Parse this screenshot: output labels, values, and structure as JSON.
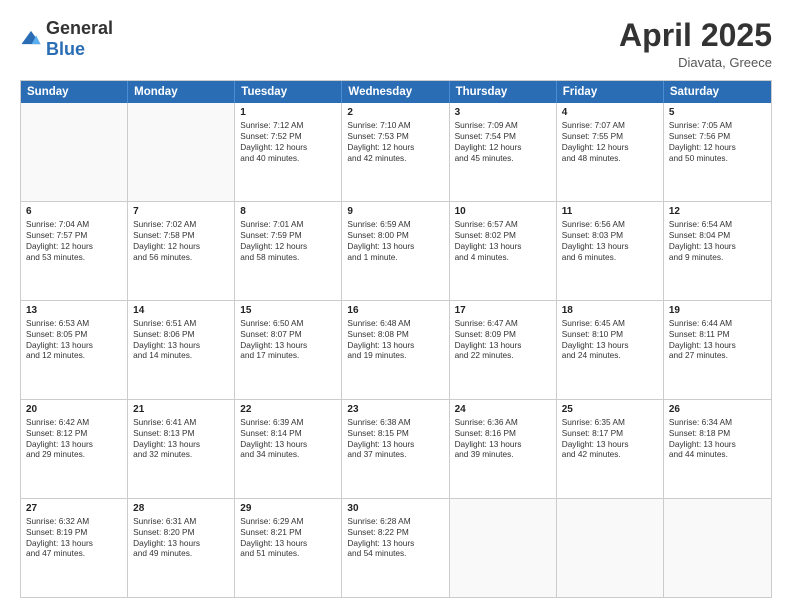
{
  "logo": {
    "general": "General",
    "blue": "Blue"
  },
  "title": "April 2025",
  "location": "Diavata, Greece",
  "days_of_week": [
    "Sunday",
    "Monday",
    "Tuesday",
    "Wednesday",
    "Thursday",
    "Friday",
    "Saturday"
  ],
  "rows": [
    [
      {
        "day": "",
        "lines": []
      },
      {
        "day": "",
        "lines": []
      },
      {
        "day": "1",
        "lines": [
          "Sunrise: 7:12 AM",
          "Sunset: 7:52 PM",
          "Daylight: 12 hours",
          "and 40 minutes."
        ]
      },
      {
        "day": "2",
        "lines": [
          "Sunrise: 7:10 AM",
          "Sunset: 7:53 PM",
          "Daylight: 12 hours",
          "and 42 minutes."
        ]
      },
      {
        "day": "3",
        "lines": [
          "Sunrise: 7:09 AM",
          "Sunset: 7:54 PM",
          "Daylight: 12 hours",
          "and 45 minutes."
        ]
      },
      {
        "day": "4",
        "lines": [
          "Sunrise: 7:07 AM",
          "Sunset: 7:55 PM",
          "Daylight: 12 hours",
          "and 48 minutes."
        ]
      },
      {
        "day": "5",
        "lines": [
          "Sunrise: 7:05 AM",
          "Sunset: 7:56 PM",
          "Daylight: 12 hours",
          "and 50 minutes."
        ]
      }
    ],
    [
      {
        "day": "6",
        "lines": [
          "Sunrise: 7:04 AM",
          "Sunset: 7:57 PM",
          "Daylight: 12 hours",
          "and 53 minutes."
        ]
      },
      {
        "day": "7",
        "lines": [
          "Sunrise: 7:02 AM",
          "Sunset: 7:58 PM",
          "Daylight: 12 hours",
          "and 56 minutes."
        ]
      },
      {
        "day": "8",
        "lines": [
          "Sunrise: 7:01 AM",
          "Sunset: 7:59 PM",
          "Daylight: 12 hours",
          "and 58 minutes."
        ]
      },
      {
        "day": "9",
        "lines": [
          "Sunrise: 6:59 AM",
          "Sunset: 8:00 PM",
          "Daylight: 13 hours",
          "and 1 minute."
        ]
      },
      {
        "day": "10",
        "lines": [
          "Sunrise: 6:57 AM",
          "Sunset: 8:02 PM",
          "Daylight: 13 hours",
          "and 4 minutes."
        ]
      },
      {
        "day": "11",
        "lines": [
          "Sunrise: 6:56 AM",
          "Sunset: 8:03 PM",
          "Daylight: 13 hours",
          "and 6 minutes."
        ]
      },
      {
        "day": "12",
        "lines": [
          "Sunrise: 6:54 AM",
          "Sunset: 8:04 PM",
          "Daylight: 13 hours",
          "and 9 minutes."
        ]
      }
    ],
    [
      {
        "day": "13",
        "lines": [
          "Sunrise: 6:53 AM",
          "Sunset: 8:05 PM",
          "Daylight: 13 hours",
          "and 12 minutes."
        ]
      },
      {
        "day": "14",
        "lines": [
          "Sunrise: 6:51 AM",
          "Sunset: 8:06 PM",
          "Daylight: 13 hours",
          "and 14 minutes."
        ]
      },
      {
        "day": "15",
        "lines": [
          "Sunrise: 6:50 AM",
          "Sunset: 8:07 PM",
          "Daylight: 13 hours",
          "and 17 minutes."
        ]
      },
      {
        "day": "16",
        "lines": [
          "Sunrise: 6:48 AM",
          "Sunset: 8:08 PM",
          "Daylight: 13 hours",
          "and 19 minutes."
        ]
      },
      {
        "day": "17",
        "lines": [
          "Sunrise: 6:47 AM",
          "Sunset: 8:09 PM",
          "Daylight: 13 hours",
          "and 22 minutes."
        ]
      },
      {
        "day": "18",
        "lines": [
          "Sunrise: 6:45 AM",
          "Sunset: 8:10 PM",
          "Daylight: 13 hours",
          "and 24 minutes."
        ]
      },
      {
        "day": "19",
        "lines": [
          "Sunrise: 6:44 AM",
          "Sunset: 8:11 PM",
          "Daylight: 13 hours",
          "and 27 minutes."
        ]
      }
    ],
    [
      {
        "day": "20",
        "lines": [
          "Sunrise: 6:42 AM",
          "Sunset: 8:12 PM",
          "Daylight: 13 hours",
          "and 29 minutes."
        ]
      },
      {
        "day": "21",
        "lines": [
          "Sunrise: 6:41 AM",
          "Sunset: 8:13 PM",
          "Daylight: 13 hours",
          "and 32 minutes."
        ]
      },
      {
        "day": "22",
        "lines": [
          "Sunrise: 6:39 AM",
          "Sunset: 8:14 PM",
          "Daylight: 13 hours",
          "and 34 minutes."
        ]
      },
      {
        "day": "23",
        "lines": [
          "Sunrise: 6:38 AM",
          "Sunset: 8:15 PM",
          "Daylight: 13 hours",
          "and 37 minutes."
        ]
      },
      {
        "day": "24",
        "lines": [
          "Sunrise: 6:36 AM",
          "Sunset: 8:16 PM",
          "Daylight: 13 hours",
          "and 39 minutes."
        ]
      },
      {
        "day": "25",
        "lines": [
          "Sunrise: 6:35 AM",
          "Sunset: 8:17 PM",
          "Daylight: 13 hours",
          "and 42 minutes."
        ]
      },
      {
        "day": "26",
        "lines": [
          "Sunrise: 6:34 AM",
          "Sunset: 8:18 PM",
          "Daylight: 13 hours",
          "and 44 minutes."
        ]
      }
    ],
    [
      {
        "day": "27",
        "lines": [
          "Sunrise: 6:32 AM",
          "Sunset: 8:19 PM",
          "Daylight: 13 hours",
          "and 47 minutes."
        ]
      },
      {
        "day": "28",
        "lines": [
          "Sunrise: 6:31 AM",
          "Sunset: 8:20 PM",
          "Daylight: 13 hours",
          "and 49 minutes."
        ]
      },
      {
        "day": "29",
        "lines": [
          "Sunrise: 6:29 AM",
          "Sunset: 8:21 PM",
          "Daylight: 13 hours",
          "and 51 minutes."
        ]
      },
      {
        "day": "30",
        "lines": [
          "Sunrise: 6:28 AM",
          "Sunset: 8:22 PM",
          "Daylight: 13 hours",
          "and 54 minutes."
        ]
      },
      {
        "day": "",
        "lines": []
      },
      {
        "day": "",
        "lines": []
      },
      {
        "day": "",
        "lines": []
      }
    ]
  ]
}
